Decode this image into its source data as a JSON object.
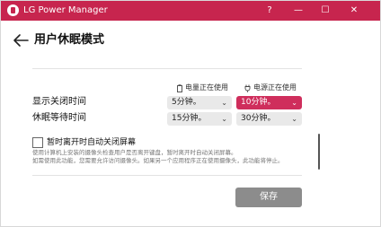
{
  "window": {
    "title": "LG Power Manager",
    "controls": {
      "help": "?",
      "minimize": "—",
      "maximize": "☐",
      "close": "✕"
    }
  },
  "page": {
    "title": "用户休眠模式"
  },
  "columns": {
    "battery": {
      "label": "电量正在使用",
      "icon": "battery-icon"
    },
    "power": {
      "label": "电源正在使用",
      "icon": "plug-icon"
    }
  },
  "rows": [
    {
      "label": "显示关闭时间",
      "battery_value": "5分钟。",
      "power_value": "10分钟。"
    },
    {
      "label": "休眠等待时间",
      "battery_value": "15分钟。",
      "power_value": "30分钟。"
    }
  ],
  "auto_lock": {
    "label": "暂时离开时自动关闭屏幕",
    "checked": false,
    "description_line1": "使用计算机上安装的摄像头检查用户是否离开键盘，暂时离开时自动关闭屏幕。",
    "description_line2": "如需使用此功能，您需要允许访问摄像头。如果另一个应用程序正在使用摄像头，此功能将停止。"
  },
  "save_label": "保存",
  "colors": {
    "accent": "#c7254e",
    "active_select": "#cf2e5c",
    "save_button": "#8c8c8c"
  }
}
